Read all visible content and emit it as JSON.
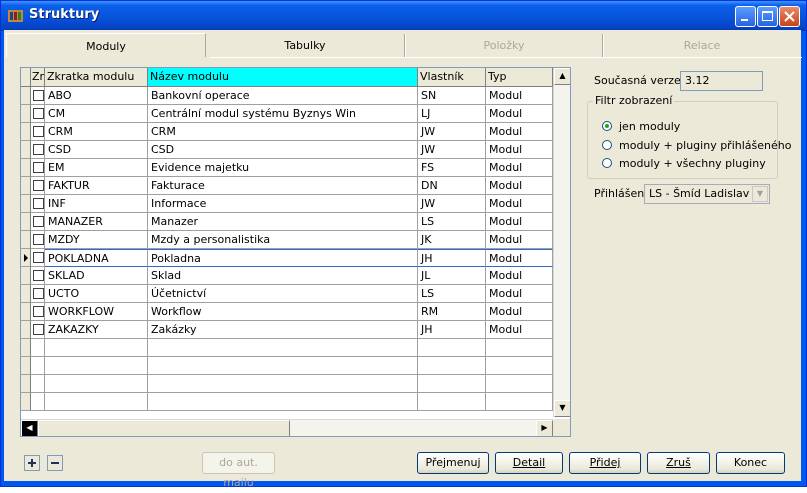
{
  "window": {
    "title": "Struktury"
  },
  "tabs": [
    {
      "label": "Moduly",
      "active": true
    },
    {
      "label": "Tabulky",
      "active": false
    },
    {
      "label": "Položky",
      "disabled": true
    },
    {
      "label": "Relace",
      "disabled": true
    }
  ],
  "grid": {
    "headers": [
      "Zn",
      "Zkratka modulu",
      "Název modulu",
      "Vlastník",
      "Typ"
    ],
    "highlighted_header": "Název modulu",
    "current_row": 9,
    "rows": [
      {
        "code": "ABO",
        "name": "Bankovní operace",
        "owner": "SN",
        "type": "Modul"
      },
      {
        "code": "CM",
        "name": "Centrální modul systému Byznys Win",
        "owner": "LJ",
        "type": "Modul"
      },
      {
        "code": "CRM",
        "name": "CRM",
        "owner": "JW",
        "type": "Modul"
      },
      {
        "code": "CSD",
        "name": "CSD",
        "owner": "JW",
        "type": "Modul"
      },
      {
        "code": "EM",
        "name": "Evidence majetku",
        "owner": "FS",
        "type": "Modul"
      },
      {
        "code": "FAKTUR",
        "name": "Fakturace",
        "owner": "DN",
        "type": "Modul"
      },
      {
        "code": "INF",
        "name": "Informace",
        "owner": "JW",
        "type": "Modul"
      },
      {
        "code": "MANAZER",
        "name": "Manazer",
        "owner": "LS",
        "type": "Modul"
      },
      {
        "code": "MZDY",
        "name": "Mzdy a personalistika",
        "owner": "JK",
        "type": "Modul"
      },
      {
        "code": "POKLADNA",
        "name": "Pokladna",
        "owner": "JH",
        "type": "Modul"
      },
      {
        "code": "SKLAD",
        "name": "Sklad",
        "owner": "JL",
        "type": "Modul"
      },
      {
        "code": "UCTO",
        "name": "Účetnictví",
        "owner": "LS",
        "type": "Modul"
      },
      {
        "code": "WORKFLOW",
        "name": "Workflow",
        "owner": "RM",
        "type": "Modul"
      },
      {
        "code": "ZAKAZKY",
        "name": "Zakázky",
        "owner": "JH",
        "type": "Modul"
      }
    ]
  },
  "panel": {
    "version_label": "Současná verze:",
    "version_value": "3.12",
    "filter_legend": "Filtr zobrazení",
    "filter_options": [
      {
        "label": "jen moduly",
        "selected": true
      },
      {
        "label": "moduly + pluginy přihlášeného",
        "selected": false
      },
      {
        "label": "moduly + všechny pluginy",
        "selected": false
      }
    ],
    "login_label": "Přihlášen:",
    "login_value": "LS - Šmíd Ladislav"
  },
  "buttons": {
    "mail": "do aut. mailu",
    "rename": "Přejmenuj",
    "detail": "Detail",
    "add": "Přidej",
    "cancel": "Zruš",
    "end": "Konec"
  },
  "colors": {
    "titlebar": "#0a5fe8",
    "face": "#ece9d8",
    "header_highlight": "#00ffff"
  }
}
